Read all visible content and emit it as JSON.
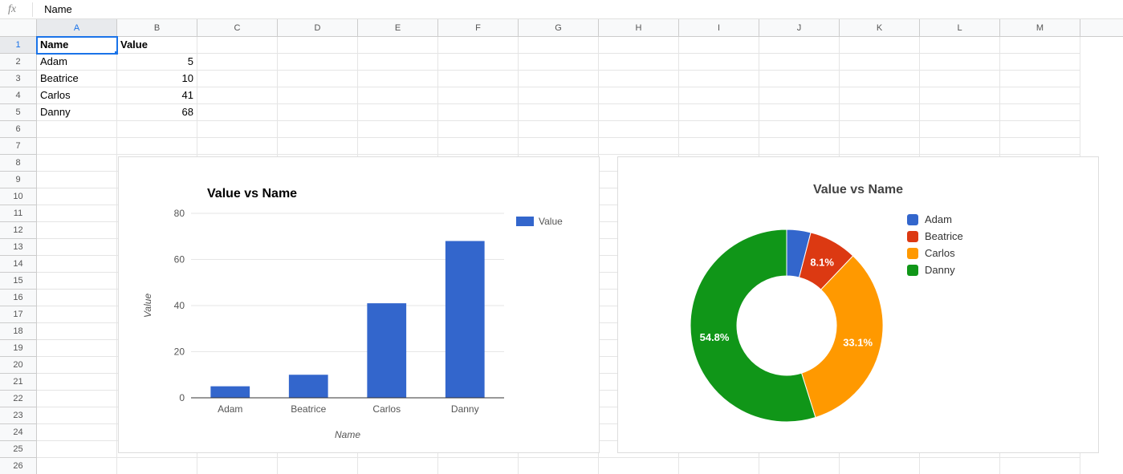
{
  "formula_bar": {
    "fx_label": "fx",
    "value": "Name"
  },
  "columns": [
    "A",
    "B",
    "C",
    "D",
    "E",
    "F",
    "G",
    "H",
    "I",
    "J",
    "K",
    "L",
    "M"
  ],
  "row_count": 26,
  "selected_cell": {
    "row": 1,
    "col": "A"
  },
  "table": {
    "headers": {
      "A": "Name",
      "B": "Value"
    },
    "rows": [
      {
        "name": "Adam",
        "value": 5
      },
      {
        "name": "Beatrice",
        "value": 10
      },
      {
        "name": "Carlos",
        "value": 41
      },
      {
        "name": "Danny",
        "value": 68
      }
    ]
  },
  "chart_data": [
    {
      "type": "bar",
      "title": "Value vs Name",
      "xlabel": "Name",
      "ylabel": "Value",
      "ylim": [
        0,
        80
      ],
      "yticks": [
        0,
        20,
        40,
        60,
        80
      ],
      "legend": [
        "Value"
      ],
      "categories": [
        "Adam",
        "Beatrice",
        "Carlos",
        "Danny"
      ],
      "values": [
        5,
        10,
        41,
        68
      ],
      "series_color": "#3366cc"
    },
    {
      "type": "donut",
      "title": "Value vs Name",
      "categories": [
        "Adam",
        "Beatrice",
        "Carlos",
        "Danny"
      ],
      "values": [
        5,
        10,
        41,
        68
      ],
      "labels_shown": [
        "8.1%",
        "33.1%",
        "54.8%"
      ],
      "colors": [
        "#3366cc",
        "#dc3912",
        "#ff9900",
        "#109618"
      ]
    }
  ]
}
